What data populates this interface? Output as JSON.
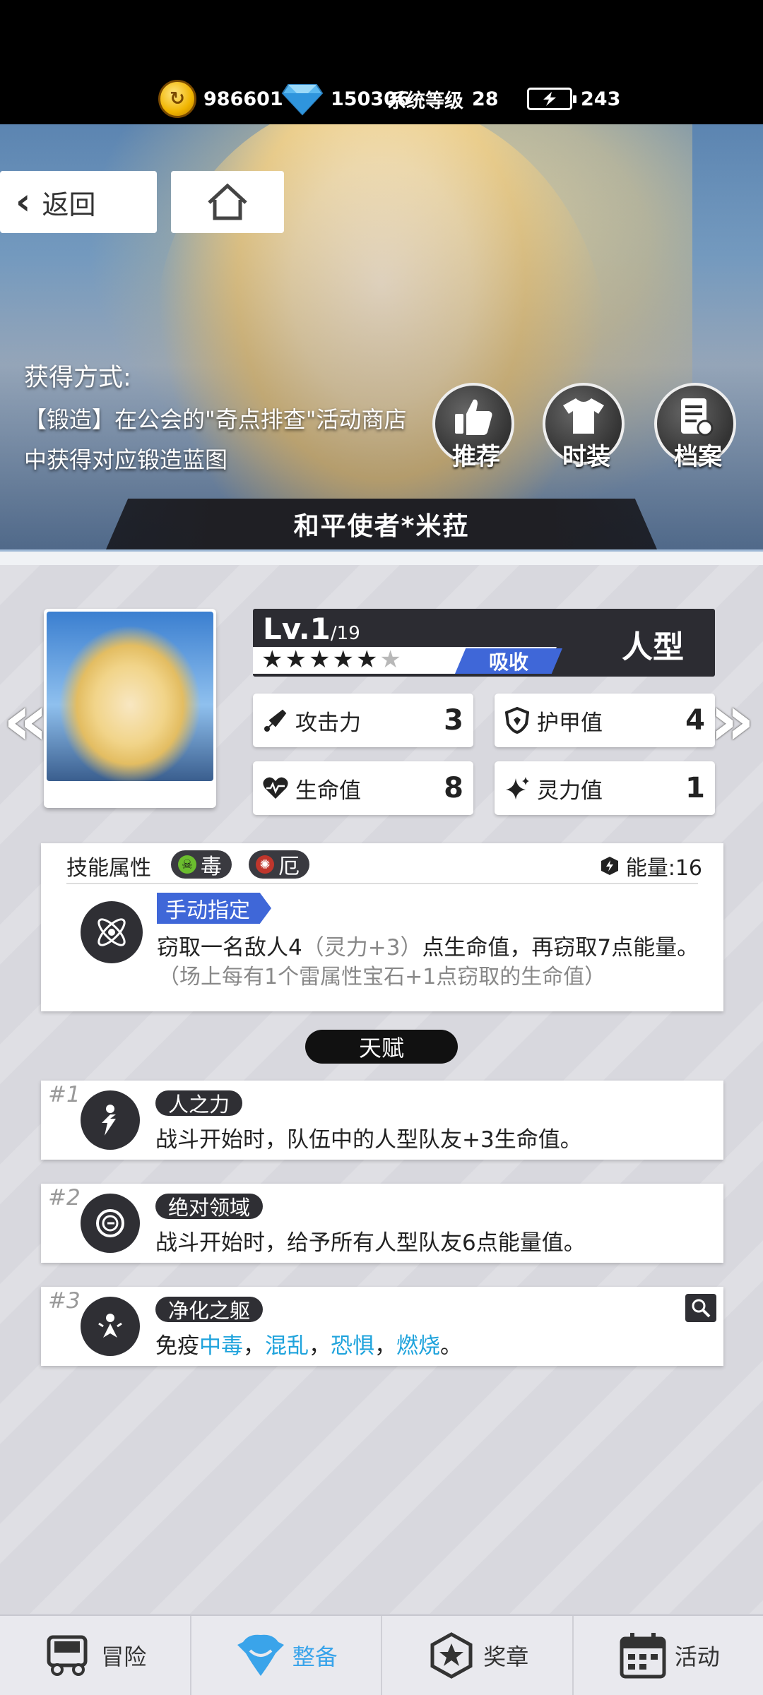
{
  "currency": {
    "coins": "986601",
    "diamonds": "150306",
    "system_level_label": "系统等级",
    "system_level": "28",
    "energy": "243"
  },
  "nav": {
    "back_label": "返回"
  },
  "obtain": {
    "title": "获得方式:",
    "desc": "【锻造】在公会的\"奇点排查\"活动商店中获得对应锻造蓝图"
  },
  "actions": {
    "recommend": "推荐",
    "costume": "时装",
    "archive": "档案"
  },
  "character": {
    "name": "和平使者*米菈",
    "level": "Lv.1",
    "level_max": "/19",
    "type": "人型",
    "stars_filled": 5,
    "stars_total": 6,
    "attribute_tag": "吸收"
  },
  "stats": {
    "attack_label": "攻击力",
    "attack": "3",
    "armor_label": "护甲值",
    "armor": "4",
    "hp_label": "生命值",
    "hp": "8",
    "spirit_label": "灵力值",
    "spirit": "1"
  },
  "skill": {
    "header": "技能属性",
    "tags": [
      "毒",
      "厄"
    ],
    "energy": "能量:16",
    "mode": "手动指定",
    "desc_main": "窃取一名敌人4",
    "desc_sub": "（灵力+3）",
    "desc_rest": "点生命值，再窃取7点能量。",
    "note": "（场上每有1个雷属性宝石+1点窃取的生命值）"
  },
  "talent_title": "天赋",
  "talents": [
    {
      "num": "#1",
      "name": "人之力",
      "desc": "战斗开始时，队伍中的人型队友+3生命值。"
    },
    {
      "num": "#2",
      "name": "绝对领域",
      "desc": "战斗开始时，给予所有人型队友6点能量值。"
    },
    {
      "num": "#3",
      "name": "净化之躯",
      "desc_prefix": "免疫",
      "keywords": [
        "中毒",
        "混乱",
        "恐惧",
        "燃烧"
      ],
      "sep": "，",
      "desc_suffix": "。"
    }
  ],
  "bottom_nav": [
    "冒险",
    "整备",
    "奖章",
    "活动"
  ],
  "colors": {
    "accent_blue": "#3f67d8",
    "keyword_cyan": "#1fa3dc",
    "nav_active": "#3aa4ea",
    "panel_dark": "#2c2c32"
  }
}
